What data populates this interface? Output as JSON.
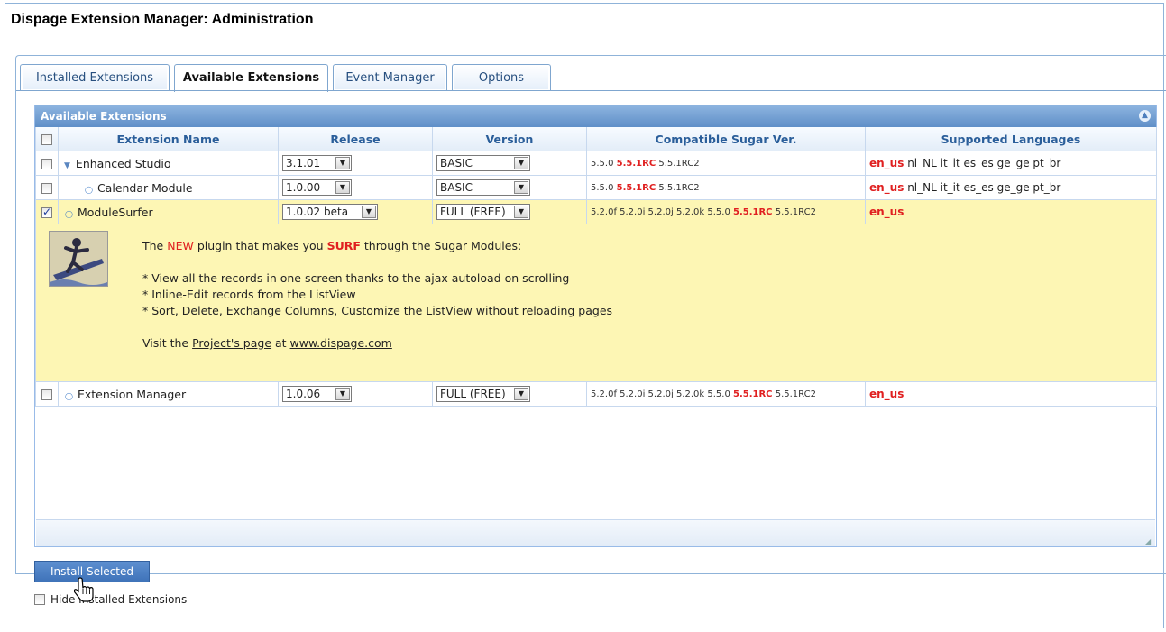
{
  "app": {
    "title": "Dispage Extension Manager: Administration"
  },
  "tabs": [
    {
      "label": "Installed Extensions",
      "active": false
    },
    {
      "label": "Available Extensions",
      "active": true
    },
    {
      "label": "Event Manager",
      "active": false
    },
    {
      "label": "Options",
      "active": false
    }
  ],
  "grid": {
    "title": "Available Extensions",
    "columns": [
      "Extension Name",
      "Release",
      "Version",
      "Compatible Sugar Ver.",
      "Supported Languages"
    ],
    "rows": [
      {
        "name": "Enhanced Studio",
        "checked": false,
        "expander": "triangle",
        "release": "3.1.01",
        "version": "BASIC",
        "compat": {
          "pre": "5.5.0",
          "hl": "5.5.1RC",
          "post": "5.5.1RC2"
        },
        "lang": {
          "main": "en_us",
          "others": "nl_NL it_it es_es ge_ge pt_br"
        }
      },
      {
        "name": "Calendar Module",
        "checked": false,
        "release": "1.0.00",
        "version": "BASIC",
        "compat": {
          "pre": "5.5.0",
          "hl": "5.5.1RC",
          "post": "5.5.1RC2"
        },
        "lang": {
          "main": "en_us",
          "others": "nl_NL it_it es_es ge_ge pt_br"
        }
      },
      {
        "name": "ModuleSurfer",
        "checked": true,
        "release": "1.0.02 beta",
        "version": "FULL (FREE)",
        "compat": {
          "pre": "5.2.0f 5.2.0i 5.2.0j 5.2.0k 5.5.0",
          "hl": "5.5.1RC",
          "post": "5.5.1RC2"
        },
        "lang": {
          "main": "en_us",
          "others": ""
        }
      },
      {
        "name": "Extension Manager",
        "checked": false,
        "release": "1.0.06",
        "version": "FULL (FREE)",
        "compat": {
          "pre": "5.2.0f 5.2.0i 5.2.0j 5.2.0k 5.5.0",
          "hl": "5.5.1RC",
          "post": "5.5.1RC2"
        },
        "lang": {
          "main": "en_us",
          "others": ""
        }
      }
    ],
    "detail": {
      "intro_a": "The ",
      "intro_new": "NEW",
      "intro_b": " plugin that makes you ",
      "intro_surf": "SURF",
      "intro_c": " through the Sugar Modules:",
      "bullet1": "* View all the records in one screen thanks to the ajax autoload on scrolling",
      "bullet2": "* Inline-Edit records from the ListView",
      "bullet3": "* Sort, Delete, Exchange Columns, Customize the ListView without reloading pages",
      "visit_a": "Visit the ",
      "visit_link": "Project's page",
      "visit_b": " at ",
      "visit_site": "www.dispage.com"
    }
  },
  "actions": {
    "install_label": "Install Selected",
    "hide_label": "Hide Installed Extensions",
    "hide_checked": false
  },
  "colors": {
    "accent": "#3f73b9",
    "highlight_row": "#fdf6b4",
    "header_blue": "#2a5e9a",
    "red": "#e02020"
  }
}
